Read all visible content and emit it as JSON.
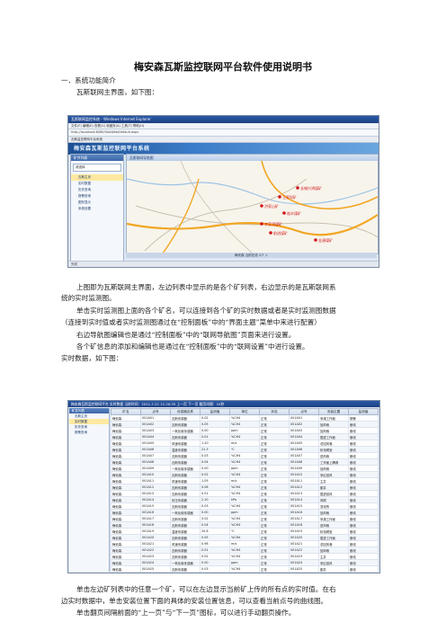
{
  "document": {
    "title": "梅安森瓦斯监控联网平台软件使用说明书",
    "section1": "一．系统功能简介",
    "intro": "瓦斯联网主界面，如下图：",
    "para1_line1": "上图即为瓦斯联网主界面，左边列表中显示的是各个矿列表，右边显示的是瓦斯联网系",
    "para1_line2": "统的实时监测图。",
    "para2_line1": "单击实时监测图上面的各个矿名，可以连接到各个矿的实时数据或者是实时监测图数据",
    "para2_line2": "（连接到实时值或者实时监测图通过在“控制面板”中的“界面主题”菜单中来进行配置）",
    "para3": "右边导航图编辑也是通过“控制面板”中的“联网导航图”页面来进行设置。",
    "para4": "各个矿信息的添加和编辑也是通过在“控制面板”中的“联网设置”中进行设置。",
    "para5": "实时数据，如下图：",
    "para6_line1": "单击左边矿列表中的任意一个矿，可以在左边显示当前矿上传的所有点的实时值。在右",
    "para6_line2": "边实时数据中，单击安装位置下面的具体的安装位置信息，可以查看当前点号的曲线图。",
    "para7": "单击翻页间隔前面的“上一页”与“下一页”图标，可以进行手动翻页操作。"
  },
  "screenshot1": {
    "window_title": "瓦斯联网监控系统 - Windows Internet Explorer",
    "menu": "文件(F)  编辑(E)  查看(V)  收藏夹(A)  工具(T)  帮助(H)",
    "address": "http://localhost:8080/GasWeb/Default.aspx",
    "tab": "瓦斯监控联网平台系统",
    "banner": "梅安森瓦斯监控联网平台系统",
    "left_header": "矿井列表",
    "left_select": "请选择",
    "left_items": [
      "瓦斯主页",
      "实时数据",
      "历史查询",
      "报警查询",
      "图形显示",
      "系统设置"
    ],
    "map_header": "瓦斯联网导航图",
    "status": "梅安森 当前在线 2/7 ＞",
    "bottom": "完成",
    "map_places": [
      "长城兴鸿煤矿",
      "王家坝矿",
      "洪家山矿",
      "裕丰煤矿",
      "李家湾煤矿",
      "前进煤矿",
      "金源煤矿"
    ],
    "colors": {
      "route": "#f2a622",
      "road": "#c8c0b0",
      "water": "#9cc3e6",
      "place": "#d0161b"
    }
  },
  "screenshot2": {
    "header": "梅安森瓦斯监控联网平台 实时数据  当前时间：2011-7-21 11:20:35  上一页 下一页  翻页间隔：10秒",
    "left_header": "矿井列表",
    "left_items": [
      "瓦斯主页",
      "实时数据",
      "历史查询",
      "报警查询"
    ],
    "columns": [
      "矿名",
      "点号",
      "传感器名称",
      "监测值",
      "单位",
      "状态",
      "点号",
      "安装位置",
      "监测值"
    ],
    "rows": [
      [
        "梅安森",
        "001A01",
        "瓦斯传感器",
        "0.02",
        "%CH4",
        "正常",
        "001A01",
        "采煤工作面",
        "报警"
      ],
      [
        "梅安森",
        "001A02",
        "瓦斯传感器",
        "0.05",
        "%CH4",
        "正常",
        "001A02",
        "回风巷",
        "断线"
      ],
      [
        "梅安森",
        "001A03",
        "一氧化碳传感器",
        "0.00",
        "ppm",
        "正常",
        "001A03",
        "回风巷",
        "断线"
      ],
      [
        "梅安森",
        "001A04",
        "瓦斯传感器",
        "0.01",
        "%CH4",
        "正常",
        "001A04",
        "掘进工作面",
        "断线"
      ],
      [
        "梅安森",
        "001A05",
        "风速传感器",
        "1.20",
        "m/s",
        "正常",
        "001A05",
        "总回风巷",
        "断线"
      ],
      [
        "梅安森",
        "001A06",
        "温度传感器",
        "21.3",
        "℃",
        "正常",
        "001A06",
        "机电硐室",
        "断线"
      ],
      [
        "梅安森",
        "001A07",
        "瓦斯传感器",
        "0.03",
        "%CH4",
        "正常",
        "001A07",
        "进风巷",
        "断线"
      ],
      [
        "梅安森",
        "001A08",
        "瓦斯传感器",
        "0.04",
        "%CH4",
        "正常",
        "001A08",
        "工作面上隅角",
        "断线"
      ],
      [
        "梅安森",
        "001A09",
        "一氧化碳传感器",
        "0.00",
        "ppm",
        "正常",
        "001A09",
        "回风巷",
        "断线"
      ],
      [
        "梅安森",
        "001A10",
        "瓦斯传感器",
        "0.02",
        "%CH4",
        "正常",
        "001A10",
        "采区回风",
        "断线"
      ],
      [
        "梅安森",
        "001A11",
        "风速传感器",
        "1.05",
        "m/s",
        "正常",
        "001A11",
        "主井",
        "断线"
      ],
      [
        "梅安森",
        "001A12",
        "瓦斯传感器",
        "0.06",
        "%CH4",
        "正常",
        "001A12",
        "副井",
        "断线"
      ],
      [
        "梅安森",
        "001A13",
        "瓦斯传感器",
        "0.01",
        "%CH4",
        "正常",
        "001A13",
        "掘进回风",
        "断线"
      ],
      [
        "梅安森",
        "001A14",
        "负压传感器",
        "2.10",
        "kPa",
        "正常",
        "001A14",
        "风硐",
        "断线"
      ],
      [
        "梅安森",
        "001A15",
        "瓦斯传感器",
        "0.03",
        "%CH4",
        "正常",
        "001A15",
        "变电所",
        "断线"
      ],
      [
        "梅安森",
        "001A16",
        "一氧化碳传感器",
        "0.00",
        "ppm",
        "正常",
        "001A16",
        "回风巷",
        "断线"
      ],
      [
        "梅安森",
        "001A17",
        "瓦斯传感器",
        "0.02",
        "%CH4",
        "正常",
        "001A17",
        "采煤工作面",
        "断线"
      ],
      [
        "梅安森",
        "001A18",
        "瓦斯传感器",
        "0.04",
        "%CH4",
        "正常",
        "001A18",
        "进风巷",
        "断线"
      ],
      [
        "梅安森",
        "001A19",
        "温度传感器",
        "20.8",
        "℃",
        "正常",
        "001A19",
        "机电硐室",
        "断线"
      ],
      [
        "梅安森",
        "001A20",
        "瓦斯传感器",
        "0.05",
        "%CH4",
        "正常",
        "001A20",
        "掘进工作面",
        "断线"
      ],
      [
        "梅安森",
        "001A21",
        "风速传感器",
        "0.98",
        "m/s",
        "正常",
        "001A21",
        "总回风巷",
        "断线"
      ],
      [
        "梅安森",
        "001A22",
        "瓦斯传感器",
        "0.01",
        "%CH4",
        "正常",
        "001A22",
        "回风巷",
        "断线"
      ],
      [
        "梅安森",
        "001A23",
        "瓦斯传感器",
        "0.02",
        "%CH4",
        "正常",
        "001A23",
        "主井",
        "断线"
      ],
      [
        "梅安森",
        "001A24",
        "一氧化碳传感器",
        "0.00",
        "ppm",
        "正常",
        "001A24",
        "采区回风",
        "断线"
      ],
      [
        "梅安森",
        "001A25",
        "瓦斯传感器",
        "0.03",
        "%CH4",
        "正常",
        "001A25",
        "副井",
        "断线"
      ],
      [
        "梅安森",
        "001A26",
        "瓦斯传感器",
        "0.02",
        "%CH4",
        "正常",
        "001A26",
        "风硐",
        "断线"
      ],
      [
        "梅安森",
        "001A27",
        "瓦斯传感器",
        "0.04",
        "%CH4",
        "正常",
        "001A27",
        "进风巷",
        "断线"
      ]
    ]
  }
}
